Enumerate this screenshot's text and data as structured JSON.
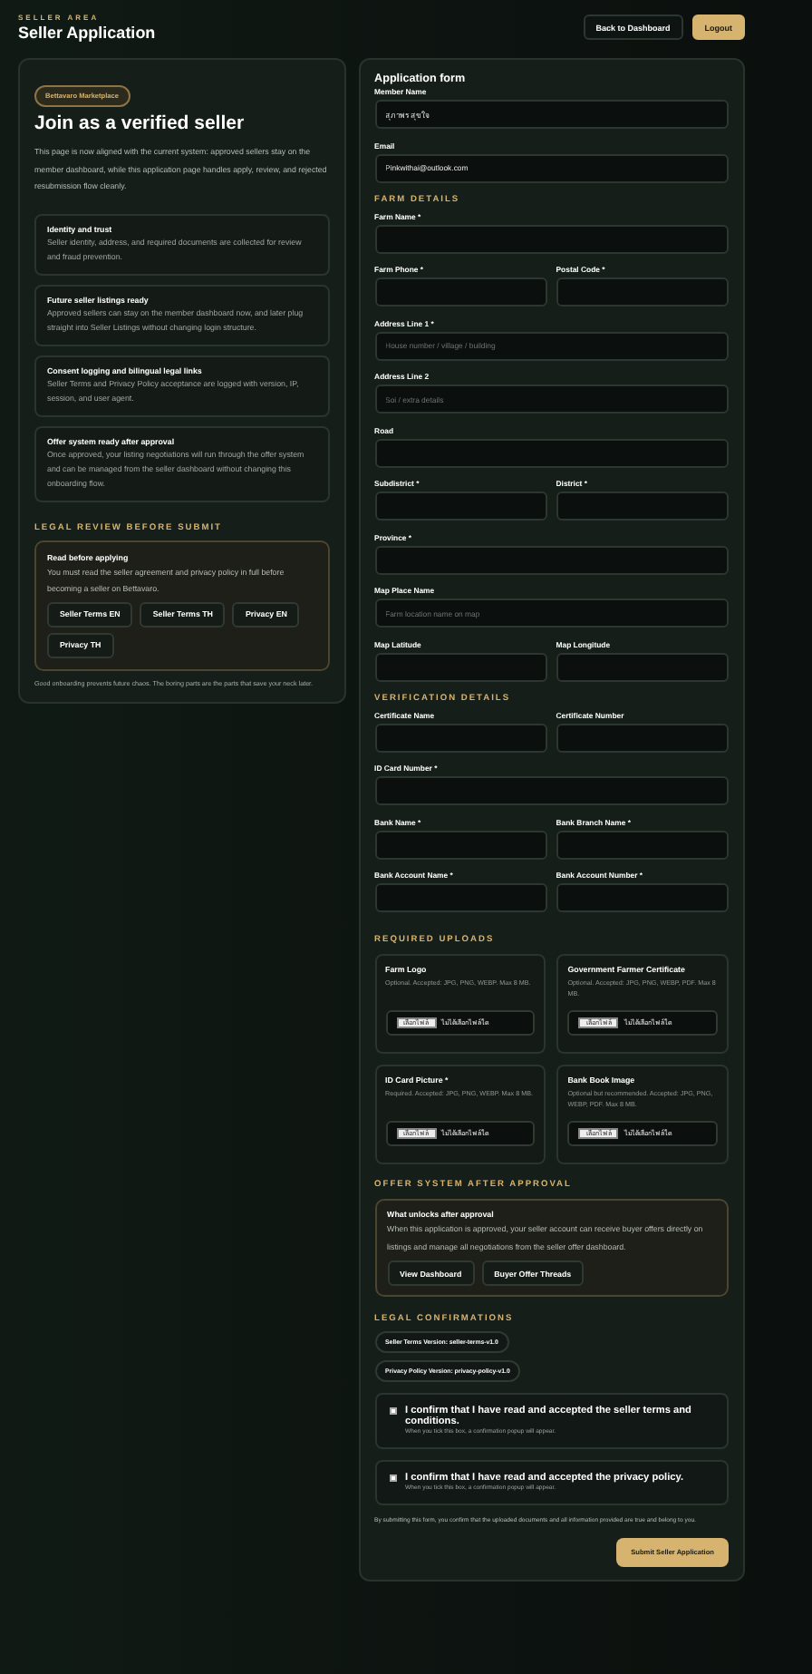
{
  "header": {
    "eyebrow": "SELLER AREA",
    "title": "Seller Application",
    "buttons": [
      {
        "label": "Back to Dashboard",
        "kind": "outline"
      },
      {
        "label": "Logout",
        "kind": "primary"
      }
    ]
  },
  "intro": {
    "badge": "Bettavaro Marketplace",
    "title": "Join as a verified seller",
    "description": "This page is now aligned with the current system: approved sellers stay on the member dashboard, while this application page handles apply, review, and rejected resubmission flow cleanly.",
    "highlights": [
      {
        "title": "Identity and trust",
        "text": "Seller identity, address, and required documents are collected for review and fraud prevention."
      },
      {
        "title": "Future seller listings ready",
        "text": "Approved sellers can stay on the member dashboard now, and later plug straight into Seller Listings without changing login structure."
      },
      {
        "title": "Consent logging and bilingual legal links",
        "text": "Seller Terms and Privacy Policy acceptance are logged with version, IP, session, and user agent."
      },
      {
        "title": "Offer system ready after approval",
        "text": "Once approved, your listing negotiations will run through the offer system and can be managed from the seller dashboard without changing this onboarding flow."
      }
    ],
    "legal_review": {
      "heading": "LEGAL REVIEW BEFORE SUBMIT",
      "title": "Read before applying",
      "text": "You must read the seller agreement and privacy policy in full before becoming a seller on Bettavaro.",
      "links": [
        "Seller Terms EN",
        "Seller Terms TH",
        "Privacy EN",
        "Privacy TH"
      ]
    },
    "footnote": "Good onboarding prevents future chaos. The boring parts are the parts that save your neck later."
  },
  "form": {
    "title": "Application form",
    "sections": [
      {
        "rows": [
          [
            {
              "label": "Member Name",
              "value": "สุภาพร สุขใจ"
            }
          ],
          [
            {
              "label": "Email",
              "value": "Pinkwithai@outlook.com"
            }
          ]
        ]
      },
      {
        "heading": "FARM DETAILS",
        "rows": [
          [
            {
              "label": "Farm Name *"
            }
          ],
          [
            {
              "label": "Farm Phone *"
            },
            {
              "label": "Postal Code *"
            }
          ],
          [
            {
              "label": "Address Line 1 *",
              "placeholder": "House number / village / building"
            }
          ],
          [
            {
              "label": "Address Line 2",
              "placeholder": "Soi / extra details"
            }
          ],
          [
            {
              "label": "Road"
            }
          ],
          [
            {
              "label": "Subdistrict *"
            },
            {
              "label": "District *"
            }
          ],
          [
            {
              "label": "Province *"
            }
          ],
          [
            {
              "label": "Map Place Name",
              "placeholder": "Farm location name on map"
            }
          ],
          [
            {
              "label": "Map Latitude"
            },
            {
              "label": "Map Longitude"
            }
          ]
        ]
      },
      {
        "heading": "VERIFICATION DETAILS",
        "rows": [
          [
            {
              "label": "Certificate Name"
            },
            {
              "label": "Certificate Number"
            }
          ],
          [
            {
              "label": "ID Card Number *"
            }
          ],
          [
            {
              "label": "Bank Name *"
            },
            {
              "label": "Bank Branch Name *"
            }
          ],
          [
            {
              "label": "Bank Account Name *"
            },
            {
              "label": "Bank Account Number *"
            }
          ]
        ]
      }
    ],
    "uploads": {
      "heading": "REQUIRED UPLOADS",
      "items": [
        {
          "title": "Farm Logo",
          "hint": "Optional. Accepted: JPG, PNG, WEBP. Max 8 MB.",
          "button": "เลือกไฟล์",
          "status": "ไม่ได้เลือกไฟล์ใด"
        },
        {
          "title": "Government Farmer Certificate",
          "hint": "Optional. Accepted: JPG, PNG, WEBP, PDF. Max 8 MB.",
          "button": "เลือกไฟล์",
          "status": "ไม่ได้เลือกไฟล์ใด"
        },
        {
          "title": "ID Card Picture *",
          "hint": "Required. Accepted: JPG, PNG, WEBP. Max 8 MB.",
          "button": "เลือกไฟล์",
          "status": "ไม่ได้เลือกไฟล์ใด"
        },
        {
          "title": "Bank Book Image",
          "hint": "Optional but recommended. Accepted: JPG, PNG, WEBP, PDF. Max 8 MB.",
          "button": "เลือกไฟล์",
          "status": "ไม่ได้เลือกไฟล์ใด"
        }
      ]
    },
    "offer": {
      "heading": "OFFER SYSTEM AFTER APPROVAL",
      "title": "What unlocks after approval",
      "text": "When this application is approved, your seller account can receive buyer offers directly on listings and manage all negotiations from the seller offer dashboard.",
      "buttons": [
        "View Dashboard",
        "Buyer Offer Threads"
      ]
    },
    "legal": {
      "heading": "LEGAL CONFIRMATIONS",
      "versions": [
        "Seller Terms Version: seller-terms-v1.0",
        "Privacy Policy Version: privacy-policy-v1.0"
      ],
      "confirmations": [
        {
          "text": "I confirm that I have read and accepted the seller terms and conditions.",
          "hint": "When you tick this box, a confirmation popup will appear.",
          "checked": false
        },
        {
          "text": "I confirm that I have read and accepted the privacy policy.",
          "hint": "When you tick this box, a confirmation popup will appear.",
          "checked": false
        }
      ],
      "disclaimer": "By submitting this form, you confirm that the uploaded documents and all information provided are true and belong to you.",
      "submit": "Submit Seller Application"
    }
  }
}
